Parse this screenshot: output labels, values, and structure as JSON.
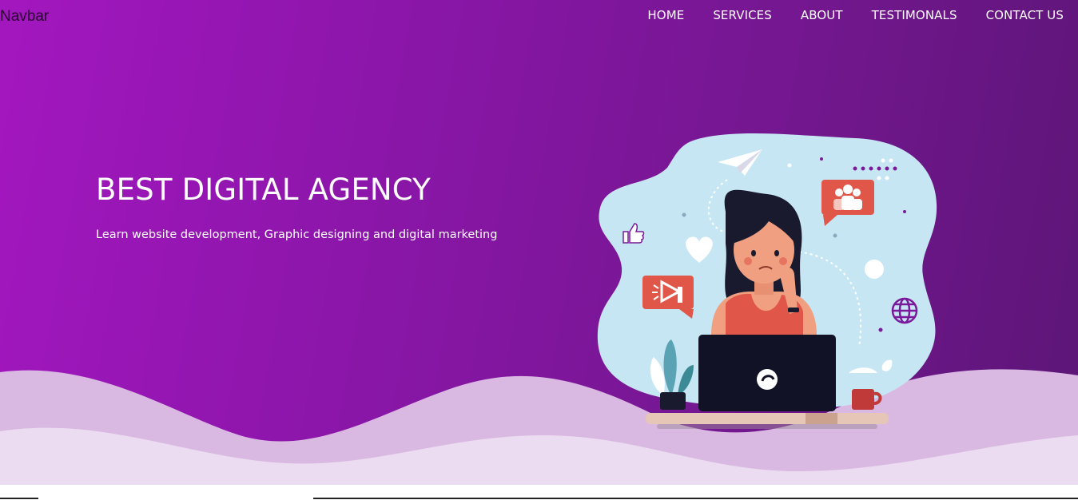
{
  "navbar": {
    "brand": "Navbar",
    "links": [
      {
        "label": "HOME"
      },
      {
        "label": "SERVICES"
      },
      {
        "label": "ABOUT"
      },
      {
        "label": "TESTIMONALS"
      },
      {
        "label": "CONTACT US"
      }
    ]
  },
  "hero": {
    "title": "BEST DIGITAL AGENCY",
    "subtitle": "Learn website development, Graphic designing and digital marketing"
  },
  "colors": {
    "gradient_start": "#a317bf",
    "gradient_end": "#5c1677",
    "wave_light": "#ecdbf0",
    "wave_mid": "#d6b6e0",
    "blob": "#c7e6f4",
    "accent_red": "#e0574a"
  },
  "icons": [
    "paper-plane-icon",
    "thumbs-up-icon",
    "heart-icon",
    "megaphone-icon",
    "group-icon",
    "globe-icon",
    "laptop-icon",
    "plant-icon",
    "coffee-cup-icon"
  ]
}
